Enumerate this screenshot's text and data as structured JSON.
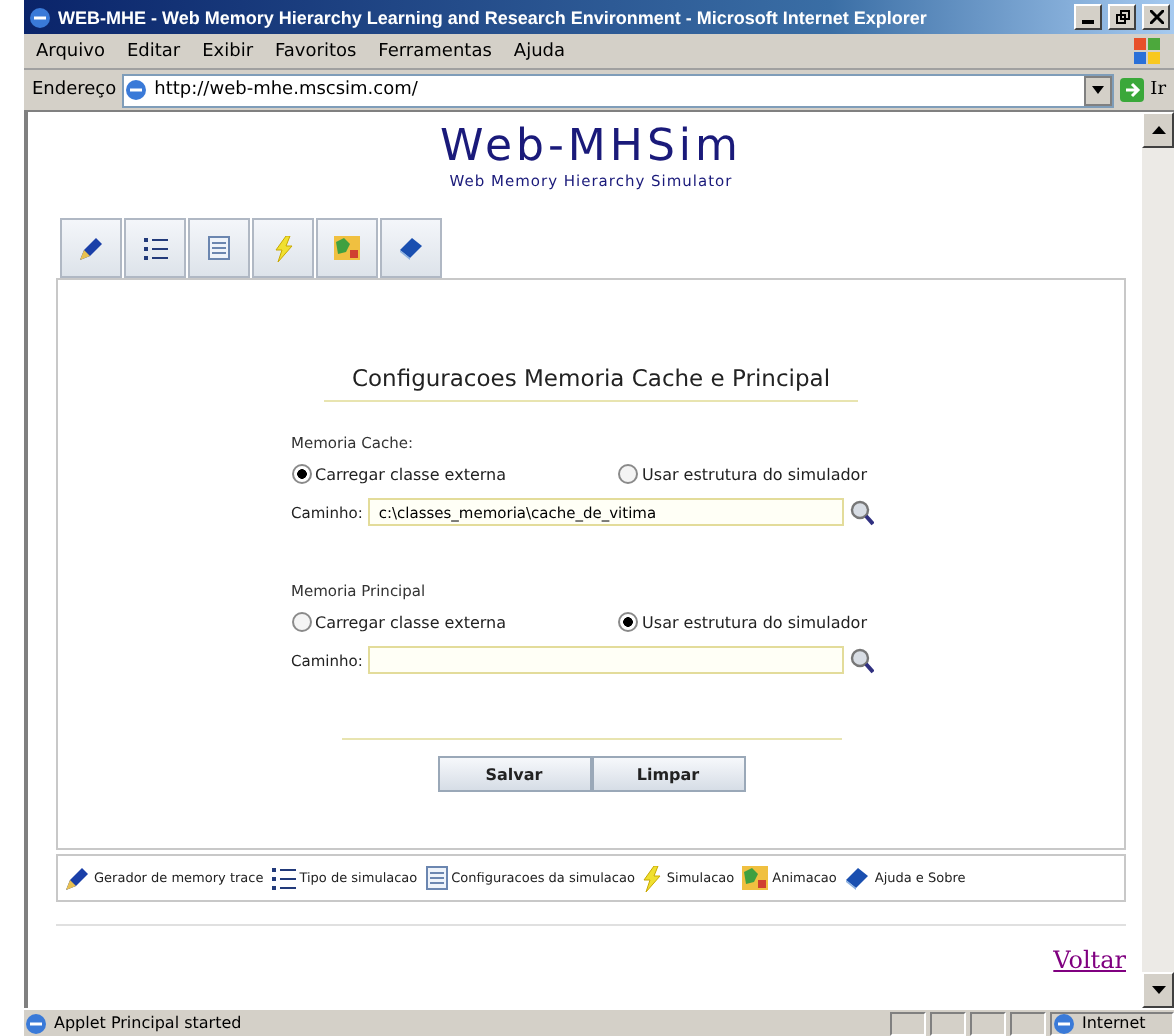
{
  "window": {
    "title": "WEB-MHE - Web Memory Hierarchy Learning and Research Environment - Microsoft Internet Explorer"
  },
  "menu": [
    "Arquivo",
    "Editar",
    "Exibir",
    "Favoritos",
    "Ferramentas",
    "Ajuda"
  ],
  "address_bar": {
    "label": "Endereço",
    "value": "http://web-mhe.mscsim.com/",
    "go": "Ir"
  },
  "logo": {
    "title": "Web-MHSim",
    "subtitle": "Web Memory Hierarchy Simulator"
  },
  "form": {
    "heading": "Configuracoes Memoria Cache e Principal",
    "sections": [
      {
        "label": "Memoria Cache:",
        "options": [
          {
            "label": "Carregar classe externa",
            "selected": true
          },
          {
            "label": "Usar estrutura do simulador",
            "selected": false
          }
        ],
        "path_label": "Caminho:",
        "path_value": "c:\\classes_memoria\\cache_de_vitima"
      },
      {
        "label": "Memoria Principal",
        "options": [
          {
            "label": "Carregar classe externa",
            "selected": false
          },
          {
            "label": "Usar estrutura do simulador",
            "selected": true
          }
        ],
        "path_label": "Caminho:"
      }
    ],
    "buttons": [
      "Salvar",
      "Limpar"
    ]
  },
  "legend": [
    "Gerador de memory trace",
    "Tipo de simulacao",
    "Configuracoes da simulacao",
    "Simulacao",
    "Animacao",
    "Ajuda e Sobre"
  ],
  "back_link": "Voltar",
  "status_bar": {
    "message": "Applet Principal started",
    "zone": "Internet"
  }
}
